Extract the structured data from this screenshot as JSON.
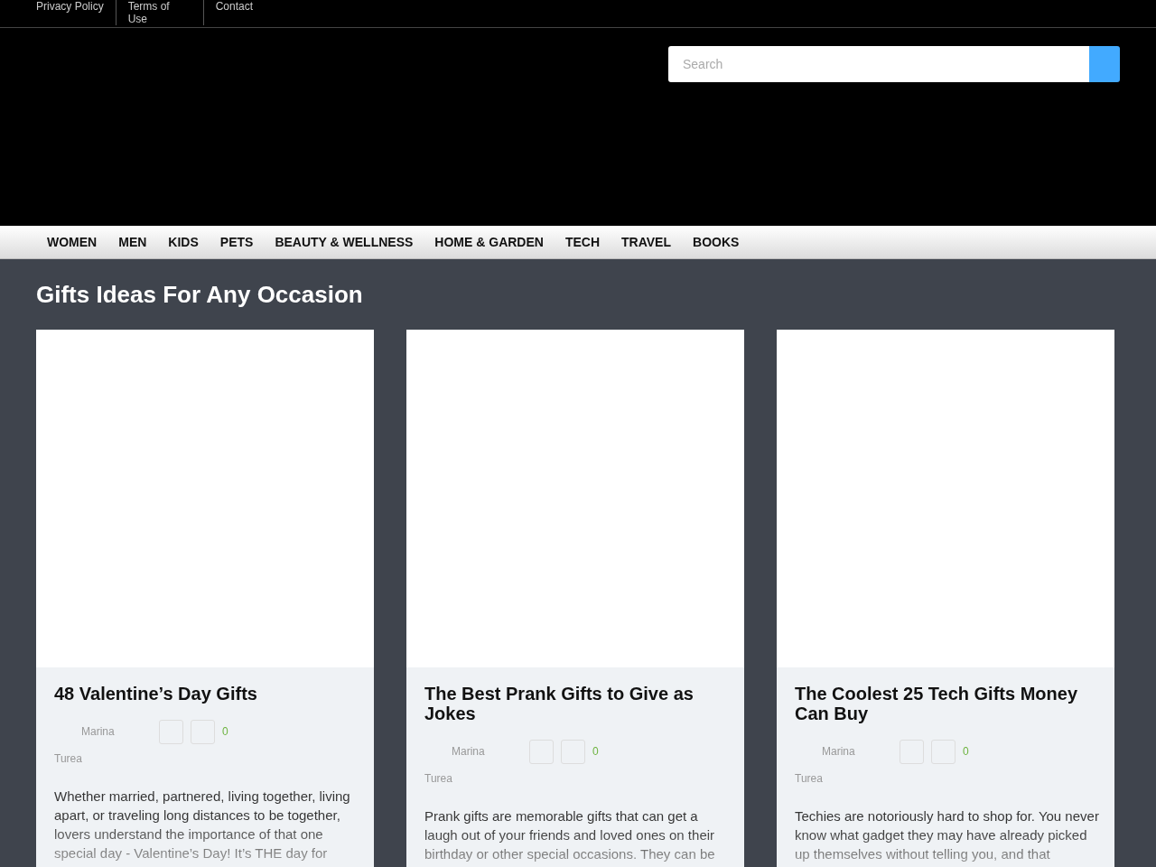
{
  "top_links": [
    "Privacy Policy",
    "Terms of Use",
    "Contact"
  ],
  "search": {
    "placeholder": "Search"
  },
  "nav": [
    "WOMEN",
    "MEN",
    "KIDS",
    "PETS",
    "BEAUTY & WELLNESS",
    "HOME & GARDEN",
    "TECH",
    "TRAVEL",
    "BOOKS"
  ],
  "heading": "Gifts Ideas For Any Occasion",
  "articles": [
    {
      "title": "48 Valentine’s Day Gifts",
      "author_first": "Marina",
      "author_last": "Turea",
      "count": "0",
      "excerpt": "Whether married, partnered, living together, living apart, or traveling long distances to be together, lovers understand the importance of that one special day - Valentine’s Day!  It’s THE day for"
    },
    {
      "title": "The Best Prank Gifts to Give as Jokes",
      "author_first": "Marina",
      "author_last": "Turea",
      "count": "0",
      "excerpt": "Prank gifts are memorable gifts that can get a laugh out of your friends and loved ones on their birthday or other special occasions. They can be"
    },
    {
      "title": "The Coolest 25 Tech Gifts Money Can Buy",
      "author_first": "Marina",
      "author_last": "Turea",
      "count": "0",
      "excerpt": "Techies are notoriously hard to shop for. You never know what gadget they may have already picked up themselves without telling you, and that"
    }
  ]
}
